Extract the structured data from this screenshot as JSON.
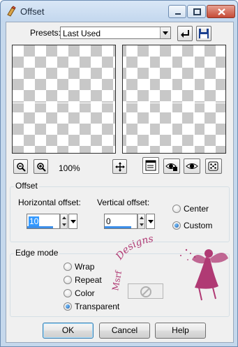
{
  "window": {
    "title": "Offset",
    "controls": {
      "minimize": "minimize-icon",
      "maximize": "maximize-icon",
      "close": "close-icon"
    }
  },
  "presets": {
    "label": "Presets:",
    "selected": "Last Used"
  },
  "zoom": {
    "level": "100%"
  },
  "offset_group": {
    "title": "Offset",
    "horizontal_label": "Horizontal offset:",
    "horizontal_value": "10",
    "vertical_label": "Vertical offset:",
    "vertical_value": "0",
    "modes": [
      {
        "label": "Center",
        "selected": false
      },
      {
        "label": "Custom",
        "selected": true
      }
    ]
  },
  "edge_mode": {
    "title": "Edge mode",
    "options": [
      {
        "label": "Wrap",
        "selected": false
      },
      {
        "label": "Repeat",
        "selected": false
      },
      {
        "label": "Color",
        "selected": false
      },
      {
        "label": "Transparent",
        "selected": true
      }
    ]
  },
  "buttons": {
    "ok": "OK",
    "cancel": "Cancel",
    "help": "Help"
  },
  "watermark": {
    "text": "Designs",
    "prefix": "Msrf"
  },
  "colors": {
    "selection": "#3399ff",
    "watermark": "#b03a74"
  }
}
